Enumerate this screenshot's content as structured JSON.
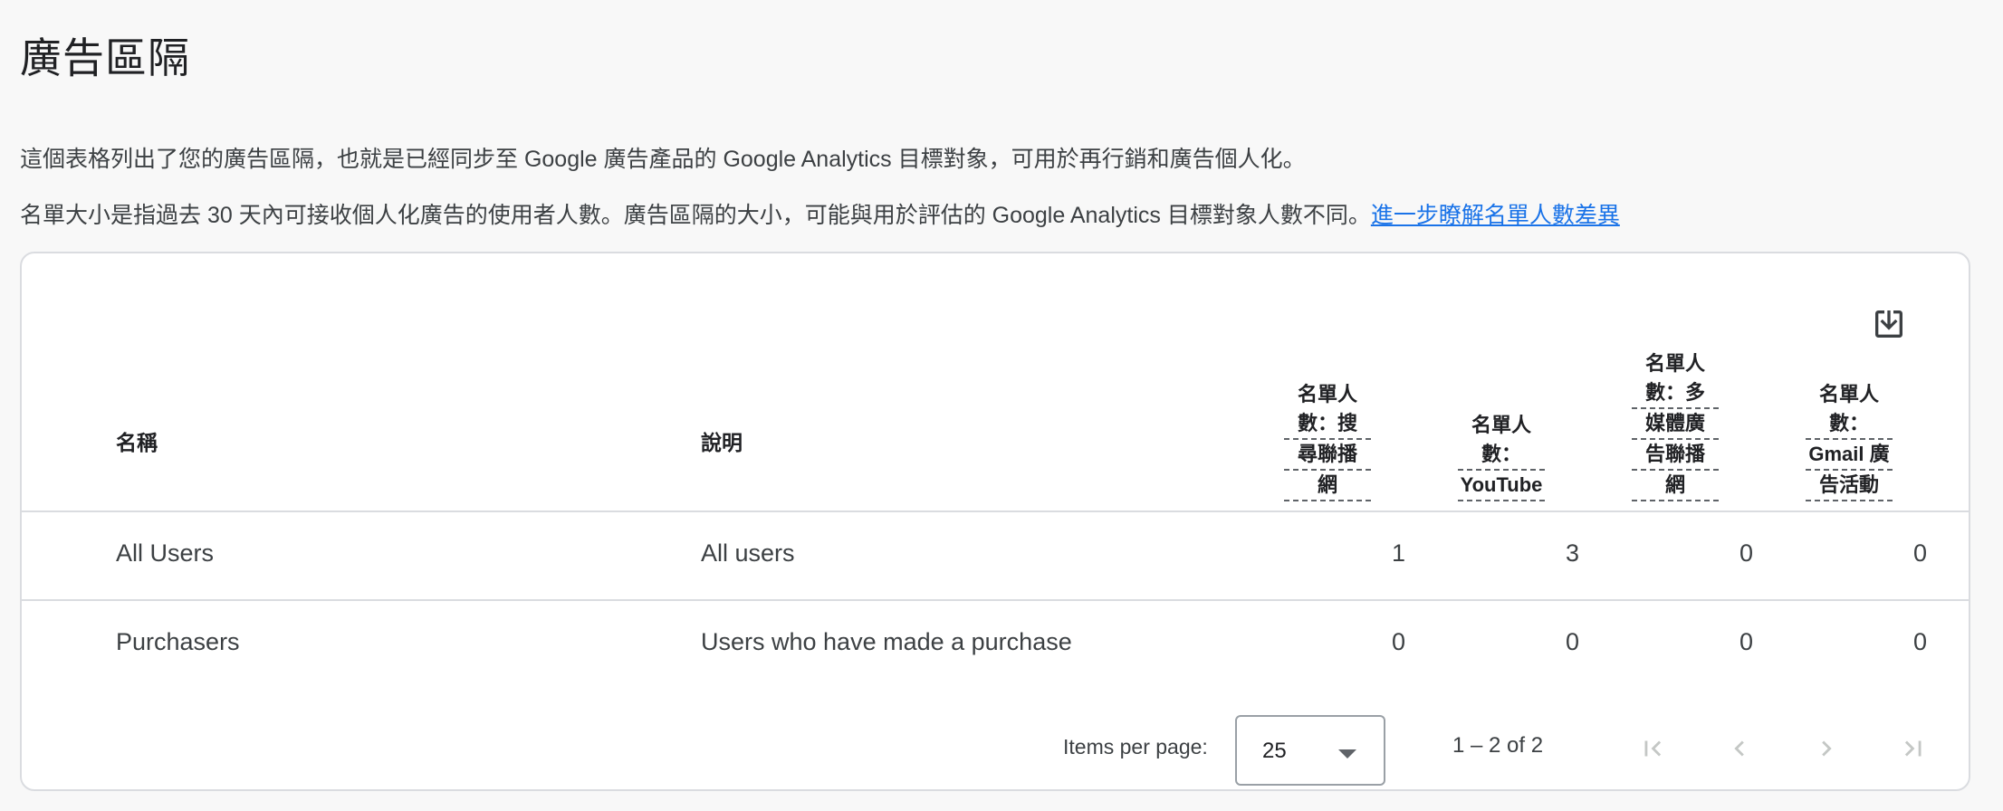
{
  "page": {
    "title": "廣告區隔",
    "description_line1": "這個表格列出了您的廣告區隔，也就是已經同步至 Google 廣告產品的 Google Analytics 目標對象，可用於再行銷和廣告個人化。",
    "description_line2": "名單大小是指過去 30 天內可接收個人化廣告的使用者人數。廣告區隔的大小，可能與用於評估的 Google Analytics 目標對象人數不同。",
    "learn_more_link": "進一步瞭解名單人數差異"
  },
  "table": {
    "download_icon": "download-icon",
    "columns": {
      "name": "名稱",
      "description": "說明",
      "search_network": [
        "名單人",
        "數：搜",
        "尋聯播",
        "網"
      ],
      "youtube": [
        "名單人",
        "數：",
        "YouTube"
      ],
      "display_network": [
        "名單人",
        "數：多",
        "媒體廣",
        "告聯播",
        "網"
      ],
      "gmail": [
        "名單人",
        "數：",
        "Gmail 廣",
        "告活動"
      ]
    },
    "rows": [
      {
        "name": "All Users",
        "description": "All users",
        "search": "1",
        "youtube": "3",
        "display": "0",
        "gmail": "0"
      },
      {
        "name": "Purchasers",
        "description": "Users who have made a purchase",
        "search": "0",
        "youtube": "0",
        "display": "0",
        "gmail": "0"
      }
    ]
  },
  "paginator": {
    "items_per_page_label": "Items per page:",
    "items_per_page_value": "25",
    "range_label": "1 – 2 of 2",
    "icons": [
      "first-page-icon",
      "previous-page-icon",
      "next-page-icon",
      "last-page-icon"
    ]
  },
  "colors": {
    "link": "#1a73e8",
    "border": "#dadce0",
    "disabled_icon": "#c4c7c5",
    "background": "#f8f8f8"
  }
}
